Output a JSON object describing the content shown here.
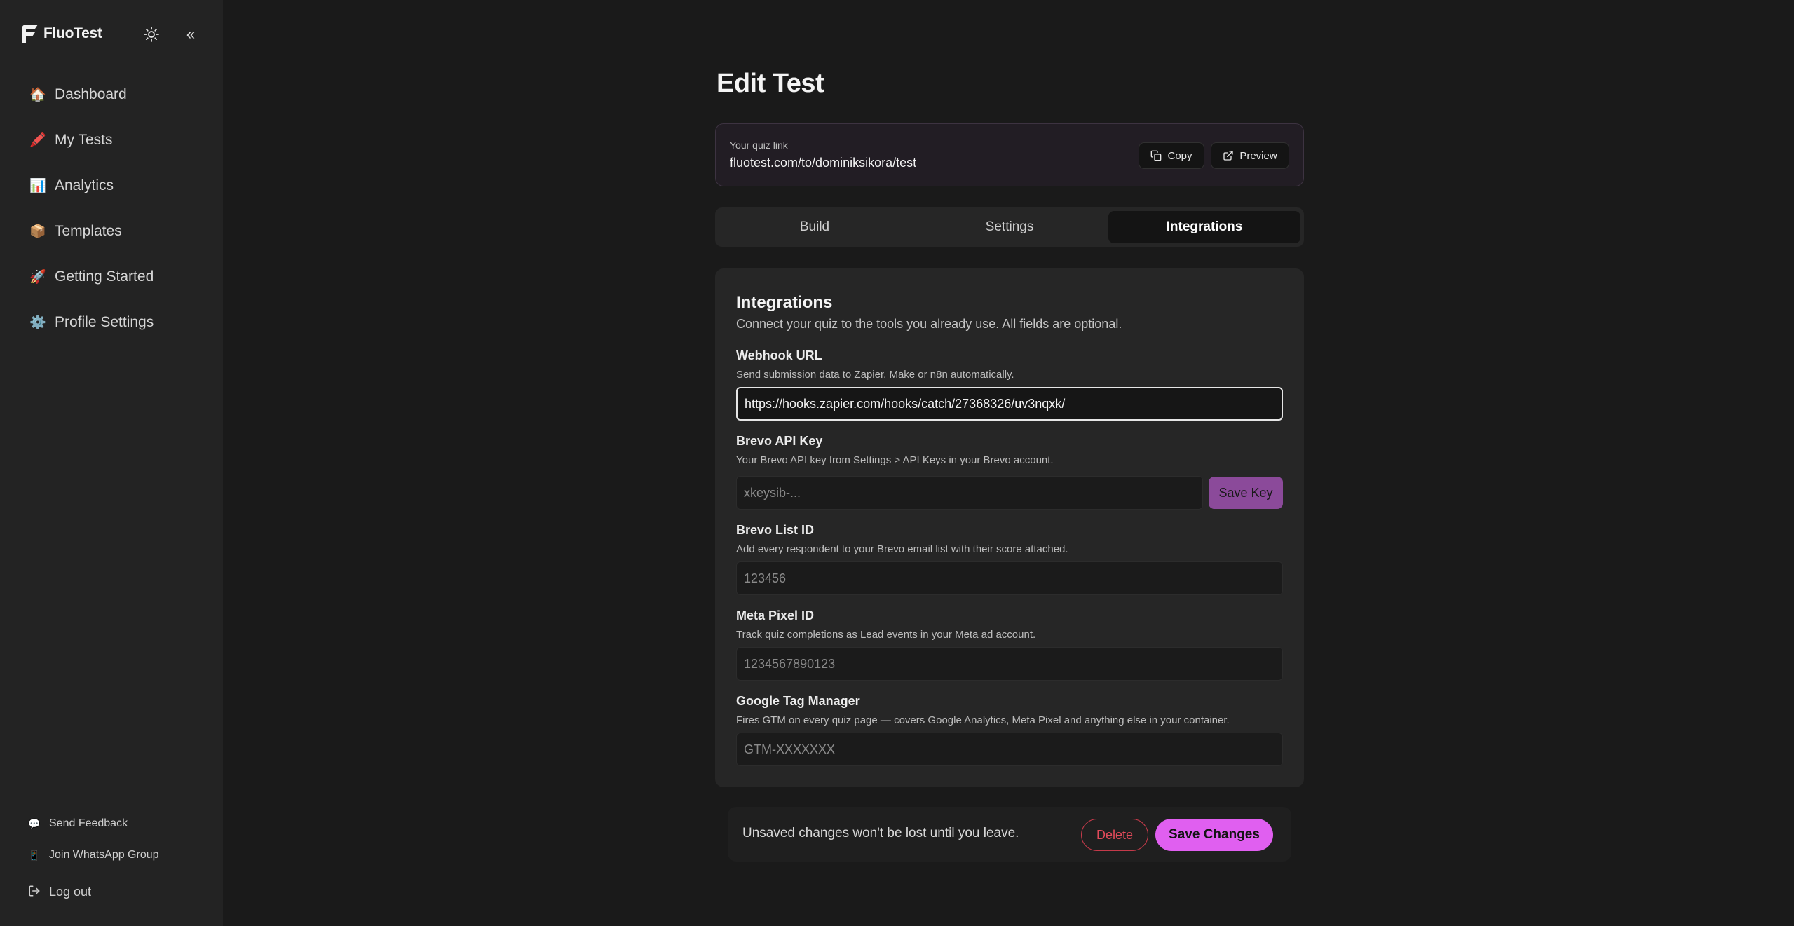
{
  "sidebar": {
    "brand": "FluoTest",
    "collapse_glyph": "«",
    "nav": [
      {
        "emoji": "🏠",
        "label": "Dashboard",
        "icon": "house-icon"
      },
      {
        "emoji": "🖍️",
        "label": "My Tests",
        "icon": "crayon-icon"
      },
      {
        "emoji": "📊",
        "label": "Analytics",
        "icon": "bar-chart-icon"
      },
      {
        "emoji": "📦",
        "label": "Templates",
        "icon": "package-icon"
      },
      {
        "emoji": "🚀",
        "label": "Getting Started",
        "icon": "rocket-icon"
      },
      {
        "emoji": "⚙️",
        "label": "Profile Settings",
        "icon": "gear-icon"
      }
    ],
    "footer": {
      "feedback": {
        "emoji": "💬",
        "label": "Send Feedback"
      },
      "whatsapp": {
        "emoji": "📱",
        "label": "Join WhatsApp Group"
      },
      "logout": {
        "label": "Log out"
      }
    }
  },
  "page": {
    "title": "Edit Test"
  },
  "quiz_link": {
    "caption": "Your quiz link",
    "url": "fluotest.com/to/dominiksikora/test",
    "copy_label": "Copy",
    "preview_label": "Preview"
  },
  "tabs": [
    {
      "label": "Build",
      "active": false
    },
    {
      "label": "Settings",
      "active": false
    },
    {
      "label": "Integrations",
      "active": true
    }
  ],
  "integrations": {
    "title": "Integrations",
    "subtitle": "Connect your quiz to the tools you already use. All fields are optional.",
    "webhook": {
      "label": "Webhook URL",
      "help": "Send submission data to Zapier, Make or n8n automatically.",
      "value": "https://hooks.zapier.com/hooks/catch/27368326/uv3nqxk/"
    },
    "brevo_key": {
      "label": "Brevo API Key",
      "help": "Your Brevo API key from Settings > API Keys in your Brevo account.",
      "placeholder": "xkeysib-...",
      "button": "Save Key"
    },
    "brevo_list": {
      "label": "Brevo List ID",
      "help": "Add every respondent to your Brevo email list with their score attached.",
      "placeholder": "123456"
    },
    "meta_pixel": {
      "label": "Meta Pixel ID",
      "help": "Track quiz completions as Lead events in your Meta ad account.",
      "placeholder": "1234567890123"
    },
    "gtm": {
      "label": "Google Tag Manager",
      "help": "Fires GTM on every quiz page — covers Google Analytics, Meta Pixel and anything else in your container.",
      "placeholder": "GTM-XXXXXXX"
    }
  },
  "bottom_bar": {
    "message": "Unsaved changes won't be lost until you leave.",
    "delete_label": "Delete",
    "save_label": "Save Changes"
  },
  "colors": {
    "accent": "#e05ff0",
    "save_key": "#8b4a9a",
    "danger": "#e34a5a"
  }
}
